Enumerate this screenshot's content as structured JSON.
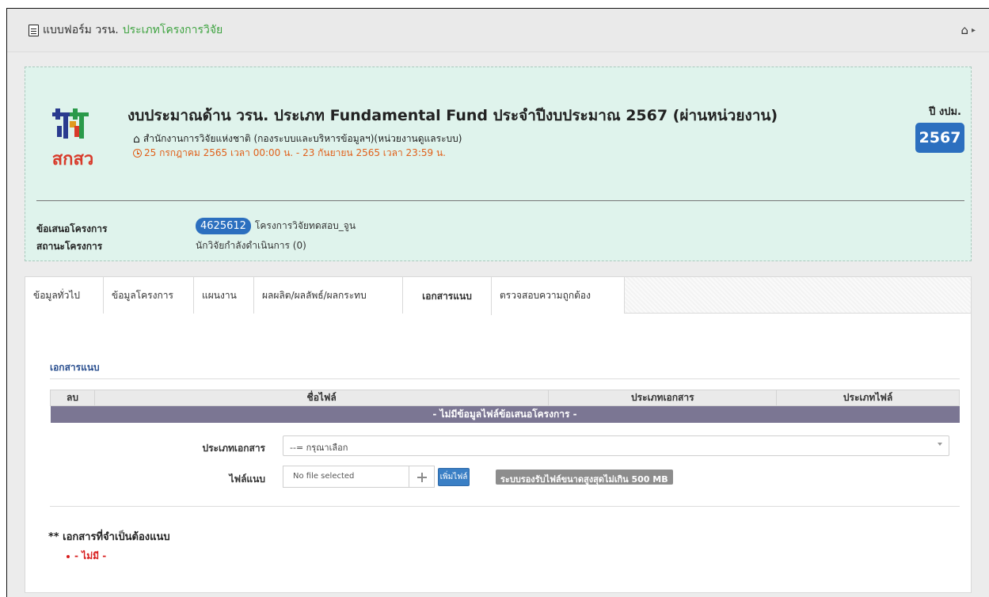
{
  "header": {
    "title_prefix": "แบบฟอร์ม วรน.",
    "title_accent": "ประเภทโครงการวิจัย",
    "home_icon": "home-icon",
    "doc_icon": "file-text-icon"
  },
  "project": {
    "logo_text": "สกสว",
    "title": "งบประมาณด้าน วรน. ประเภท Fundamental Fund ประจำปีงบประมาณ 2567 (ผ่านหน่วยงาน)",
    "org": "สำนักงานการวิจัยแห่งชาติ (กองระบบและบริหารข้อมูลฯ)(หน่วยงานดูแลระบบ)",
    "date_range": "25 กรกฎาคม 2565 เวลา 00:00 น. - 23 กันยายน 2565 เวลา 23:59 น.",
    "year_label": "ปี งปม.",
    "year": "2567",
    "proposal_label": "ข้อเสนอโครงการ",
    "proposal_id": "4625612",
    "proposal_name": "โครงการวิจัยทดสอบ_จูน",
    "status_label": "สถานะโครงการ",
    "status_value": "นักวิจัยกำลังดำเนินการ (0)"
  },
  "tabs": [
    {
      "label": "ข้อมูลทั่วไป",
      "active": false
    },
    {
      "label": "ข้อมูลโครงการ",
      "active": false
    },
    {
      "label": "แผนงาน",
      "active": false
    },
    {
      "label": "ผลผลิต/ผลลัพธ์/ผลกระทบ",
      "active": false
    },
    {
      "label": "เอกสารแนบ",
      "active": true
    },
    {
      "label": "ตรวจสอบความถูกต้อง",
      "active": false
    }
  ],
  "attachments": {
    "section_title": "เอกสารแนบ",
    "columns": [
      "ลบ",
      "ชื่อไฟล์",
      "ประเภทเอกสาร",
      "ประเภทไฟล์"
    ],
    "empty_message": "- ไม่มีข้อมูลไฟล์ข้อเสนอโครงการ -",
    "doc_type_label": "ประเภทเอกสาร",
    "doc_type_selected": "--= กรุณาเลือก",
    "file_label": "ไฟล์แนบ",
    "file_value": "No file selected",
    "add_file_label": "เพิ่มไฟล์",
    "limit_note": "ระบบรองรับไฟล์ขนาดสูงสุดไม่เกิน 500 MB"
  },
  "required": {
    "title": "** เอกสารที่จำเป็นต้องแนบ",
    "items": [
      "- ไม่มี -"
    ]
  },
  "colors": {
    "accent_green": "#3ea340",
    "badge_blue": "#2c6fbf",
    "panel_bg": "#dff3ec",
    "date_orange": "#e0601a",
    "empty_row": "#7b7693",
    "required_red": "#d81d1d"
  }
}
